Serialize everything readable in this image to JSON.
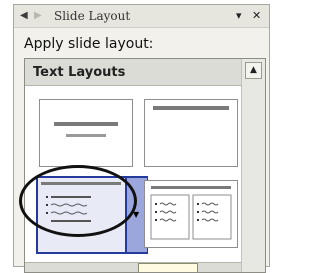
{
  "pane": {
    "title": "Slide Layout",
    "menu_icon": "chevron-down-icon",
    "close_label": "✕",
    "back_icon": "back-arrow-icon",
    "forward_icon": "forward-arrow-icon"
  },
  "apply_label": "Apply slide layout:",
  "gallery": {
    "section_title": "Text Layouts",
    "layouts": [
      {
        "icon": "title-slide-layout-icon"
      },
      {
        "icon": "title-only-layout-icon"
      },
      {
        "icon": "title-and-text-layout-icon"
      },
      {
        "icon": "title-and-two-column-text-layout-icon"
      }
    ],
    "selected_index": 2,
    "dropdown_icon": "chevron-down-icon"
  },
  "colors": {
    "selection_border": "#243a9c",
    "selection_fill": "#9ba6dc",
    "tooltip_bg": "#fffbe0"
  }
}
